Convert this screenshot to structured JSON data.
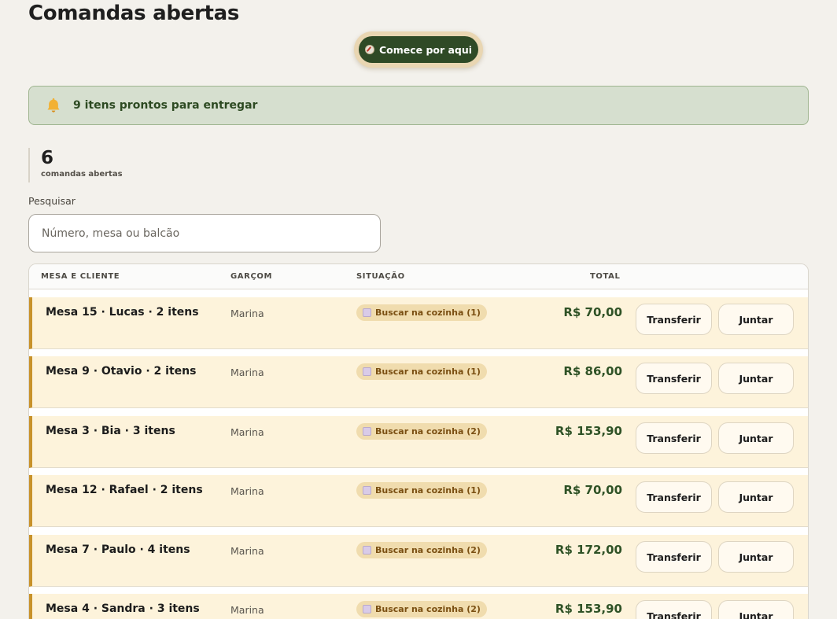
{
  "page": {
    "title": "Comandas abertas"
  },
  "start_button": {
    "label": "Comece por aqui"
  },
  "alert": {
    "text": "9 itens prontos para entregar"
  },
  "stats": {
    "count": "6",
    "label": "comandas abertas"
  },
  "search": {
    "label": "Pesquisar",
    "placeholder": "Número, mesa ou balcão",
    "value": ""
  },
  "table": {
    "headers": {
      "client": "MESA E CLIENTE",
      "waiter": "GARÇOM",
      "status": "SITUAÇÃO",
      "total": "TOTAL"
    },
    "actions": {
      "transfer": "Transferir",
      "join": "Juntar"
    },
    "rows": [
      {
        "client": "Mesa 15 · Lucas · 2 itens",
        "waiter": "Marina",
        "status": "Buscar na cozinha (1)",
        "total": "R$ 70,00"
      },
      {
        "client": "Mesa 9 · Otavio · 2 itens",
        "waiter": "Marina",
        "status": "Buscar na cozinha (1)",
        "total": "R$ 86,00"
      },
      {
        "client": "Mesa 3 · Bia · 3 itens",
        "waiter": "Marina",
        "status": "Buscar na cozinha (2)",
        "total": "R$ 153,90"
      },
      {
        "client": "Mesa 12 · Rafael · 2 itens",
        "waiter": "Marina",
        "status": "Buscar na cozinha (1)",
        "total": "R$ 70,00"
      },
      {
        "client": "Mesa 7 · Paulo · 4 itens",
        "waiter": "Marina",
        "status": "Buscar na cozinha (2)",
        "total": "R$ 172,00"
      },
      {
        "client": "Mesa 4 · Sandra · 3 itens",
        "waiter": "Marina",
        "status": "Buscar na cozinha (2)",
        "total": "R$ 153,90"
      }
    ]
  },
  "colors": {
    "background": "#f3f1ec",
    "primary": "#2f4a26",
    "alert_bg": "#d6dfcf",
    "row_bg": "#fdf3db",
    "row_accent": "#c8922a",
    "badge_bg": "#f0dcae",
    "total_text": "#2f5226"
  },
  "icons": {
    "start_button": "compass-icon",
    "alert": "bell-icon",
    "status_badge": "plate-icon"
  }
}
